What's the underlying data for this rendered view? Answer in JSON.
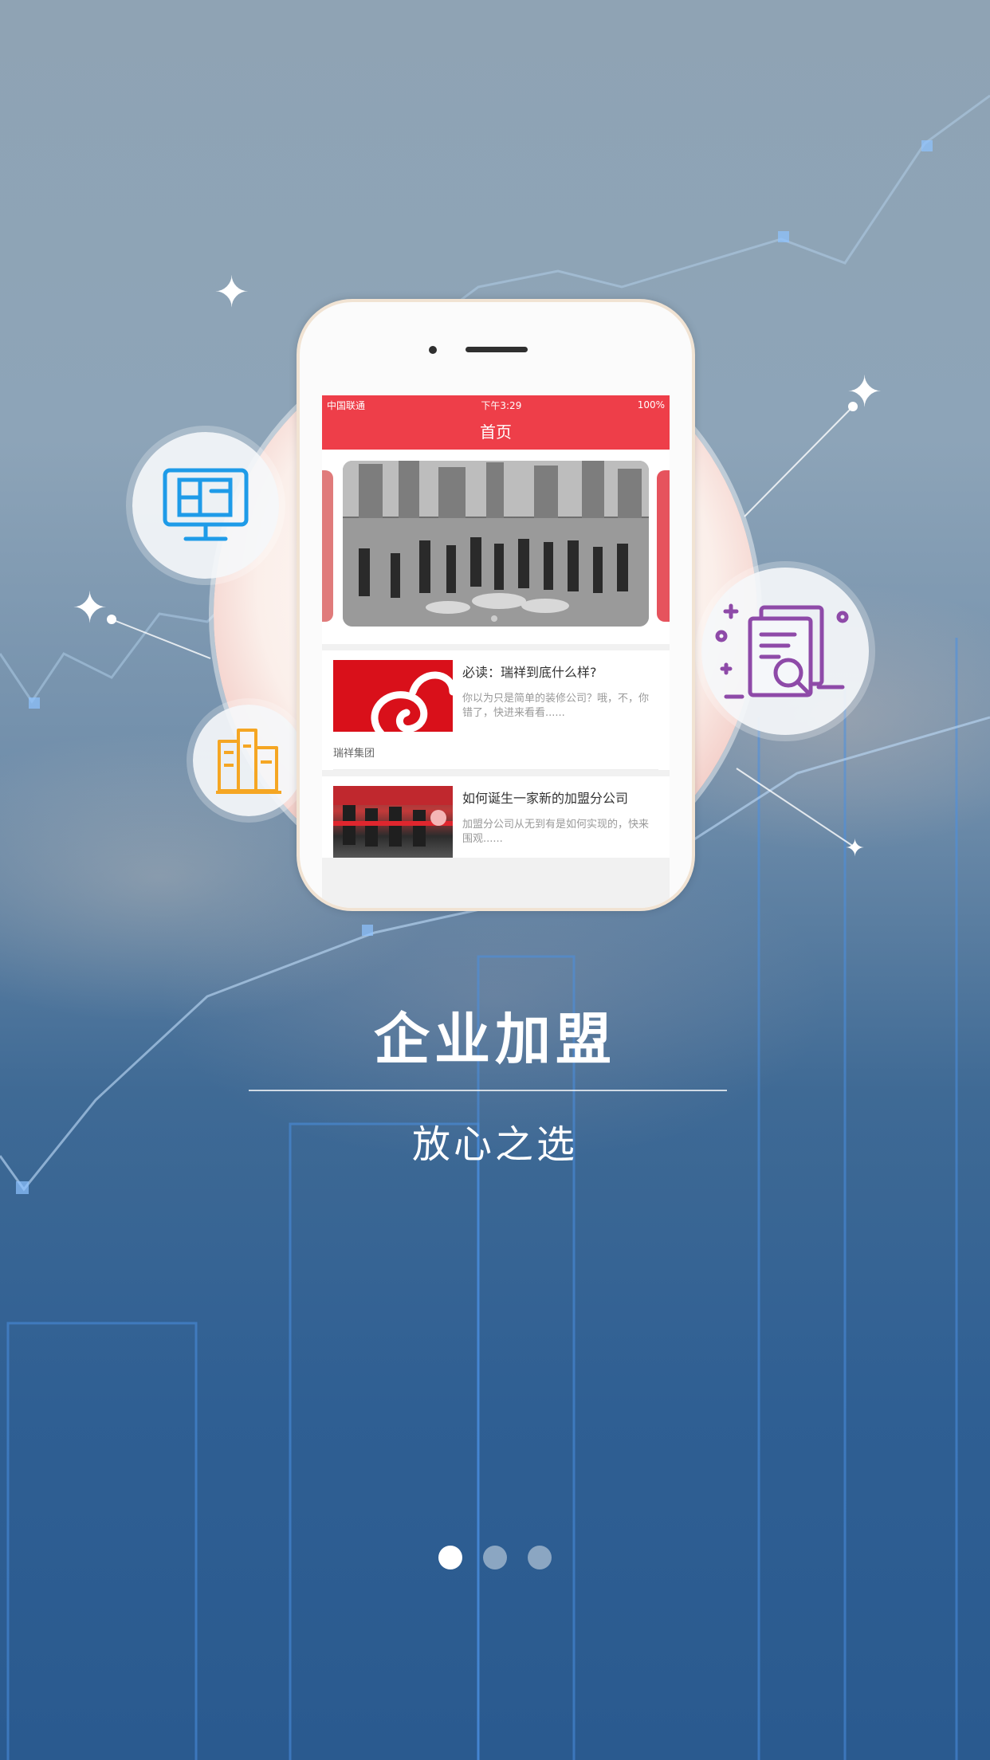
{
  "phone": {
    "status": {
      "carrier": "中国联通",
      "time": "下午3:29",
      "battery": "100%"
    },
    "nav_title": "首页",
    "articles": [
      {
        "title": "必读：瑞祥到底什么样?",
        "desc": "你以为只是简单的装修公司？哦，不，你错了，快进来看看......",
        "source": "瑞祥集团"
      },
      {
        "title": "如何诞生一家新的加盟分公司",
        "desc": "加盟分公司从无到有是如何实现的，快来围观......"
      }
    ]
  },
  "headline": {
    "title": "企业加盟",
    "subtitle": "放心之选"
  },
  "pager": {
    "count": 3,
    "active": 0
  },
  "colors": {
    "accent": "#ee3e49",
    "icon_blue": "#1e9be8",
    "icon_orange": "#f5a623",
    "icon_purple": "#8e4aa8"
  },
  "icons": [
    "monitor-layout-icon",
    "building-chart-icon",
    "document-search-icon"
  ]
}
